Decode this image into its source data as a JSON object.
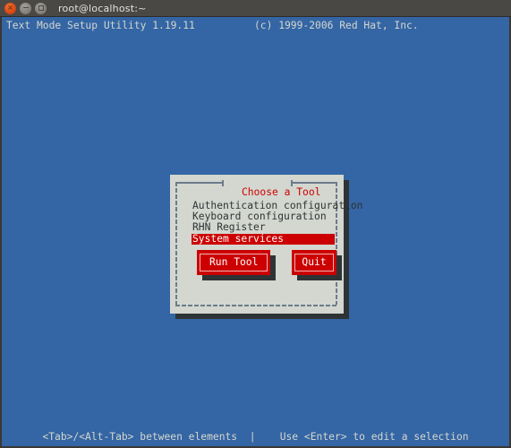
{
  "window": {
    "title": "root@localhost:~",
    "controls": [
      {
        "name": "close",
        "glyph": "×"
      },
      {
        "name": "minimize",
        "glyph": ""
      },
      {
        "name": "maximize",
        "glyph": ""
      }
    ]
  },
  "terminal": {
    "header_left": "Text Mode Setup Utility 1.19.11",
    "header_right": "(c) 1999-2006 Red Hat, Inc.",
    "footer": "<Tab>/<Alt-Tab> between elements  |    Use <Enter> to edit a selection"
  },
  "dialog": {
    "title": "Choose a Tool",
    "items": [
      {
        "label": "Authentication configuration",
        "selected": false
      },
      {
        "label": "Keyboard configuration",
        "selected": false
      },
      {
        "label": "RHN Register",
        "selected": false
      },
      {
        "label": "System services",
        "selected": true
      }
    ],
    "buttons": [
      {
        "label": "Run Tool"
      },
      {
        "label": "Quit"
      }
    ]
  },
  "colors": {
    "console_blue": "#3465a4",
    "panel_gray": "#d3d7cf",
    "accent_red": "#cc0000",
    "shadow": "#2e3436",
    "titlebar": "#4a4845",
    "text_light": "#d3d7cf"
  }
}
